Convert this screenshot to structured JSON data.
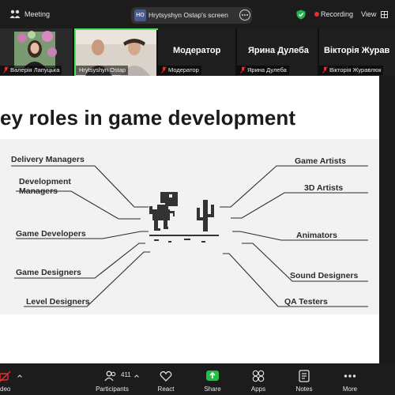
{
  "topbar": {
    "meeting_label": "Meeting",
    "share_badge": "HO",
    "share_title": "Hrytsyshyn Ostap's screen",
    "recording_label": "Recording",
    "view_label": "View"
  },
  "participants_strip": {
    "tiles": [
      {
        "name": "Валерія Лапуцька"
      },
      {
        "name": "Hrytsyshyn Ostap"
      },
      {
        "name": "Модератор",
        "big_name": "Модератор"
      },
      {
        "name": "Ярина Дулеба",
        "big_name": "Ярина Дулеба"
      },
      {
        "name": "Вікторія Журавлюк",
        "big_name": "Вікторія Журав"
      }
    ]
  },
  "slide": {
    "title": "ey roles in game development",
    "left_roles": [
      "Delivery Managers",
      "Development\nManagers",
      "Game Developers",
      "Game Designers",
      "Level Designers"
    ],
    "right_roles": [
      "Game Artists",
      "3D Artists",
      "Animators",
      "Sound Designers",
      "QA Testers"
    ]
  },
  "toolbar": {
    "video_label": "deo",
    "participants_label": "Participants",
    "participants_count": "411",
    "react_label": "React",
    "share_label": "Share",
    "apps_label": "Apps",
    "notes_label": "Notes",
    "more_label": "More"
  },
  "colors": {
    "active_speaker": "#4de65a",
    "recording": "#e5312f",
    "share": "#1fbf44",
    "muted": "#e5312f"
  }
}
